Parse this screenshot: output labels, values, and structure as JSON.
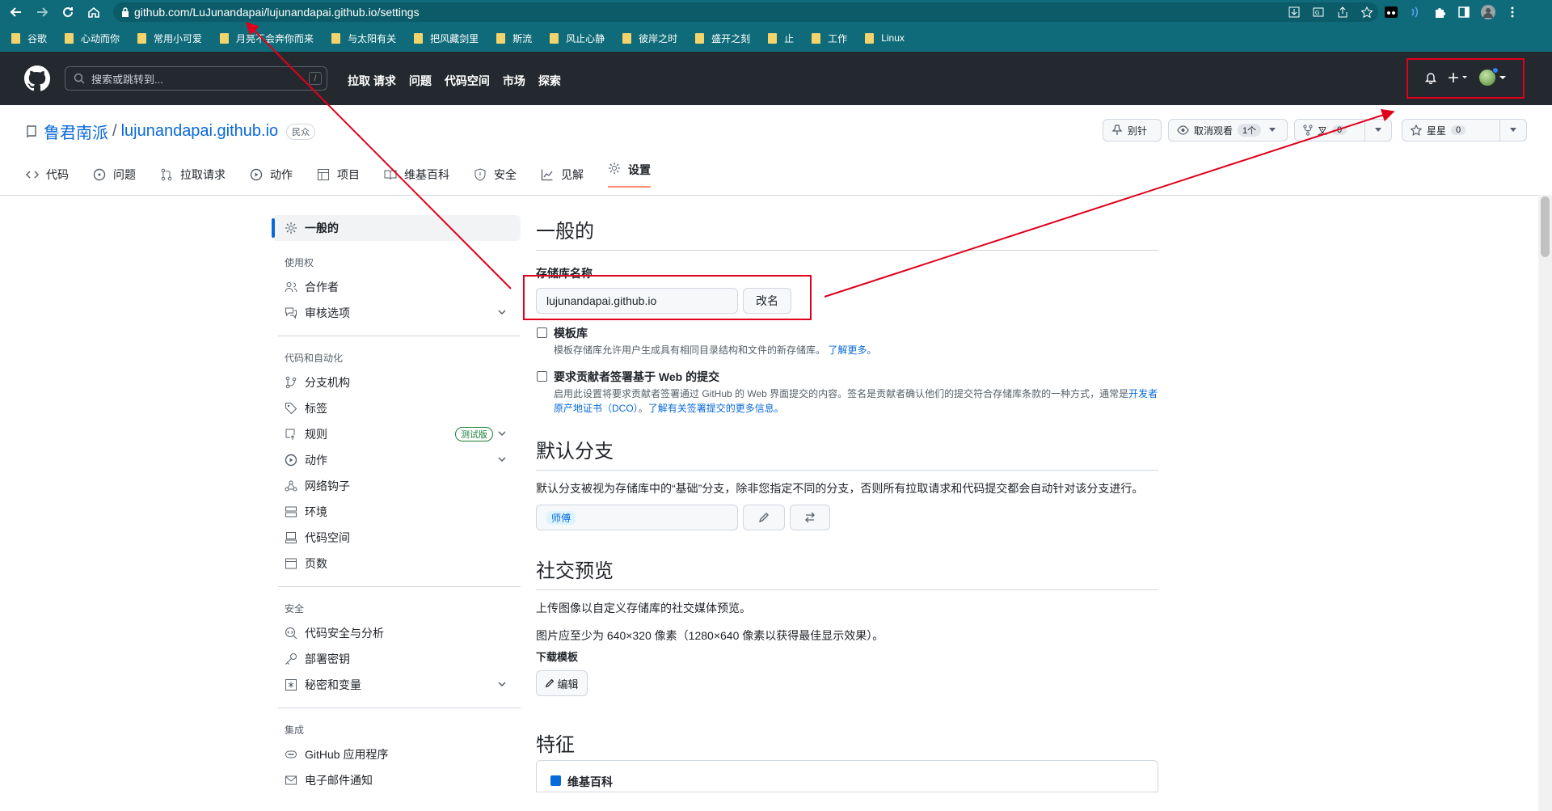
{
  "browser": {
    "url": "github.com/LuJunandapai/lujunandapai.github.io/settings",
    "bookmarks": [
      "谷歌",
      "心动而你",
      "常用小可爱",
      "月亮不会奔你而来",
      "与太阳有关",
      "把风藏剑里",
      "斯流",
      "风止心静",
      "彼岸之时",
      "盛开之刻",
      "止",
      "工作",
      "Linux"
    ]
  },
  "header": {
    "search_placeholder": "搜索或跳转到...",
    "search_hotkey": "/",
    "nav": [
      "拉取 请求",
      "问题",
      "代码空间",
      "市场",
      "探索"
    ]
  },
  "repo": {
    "owner": "鲁君南派",
    "separator": "/",
    "name": "lujunandapai.github.io",
    "visibility": "民众",
    "actions": {
      "pin": "别针",
      "unwatch": "取消观看",
      "watch_count": "1个",
      "fork_label": "叉",
      "fork_count": "0",
      "star": "星星",
      "star_count": "0"
    },
    "tabs": [
      "代码",
      "问题",
      "拉取请求",
      "动作",
      "项目",
      "维基百科",
      "安全",
      "见解",
      "设置"
    ]
  },
  "sidebar": {
    "active": "一般的",
    "groups": [
      {
        "heading": "使用权",
        "items": [
          "合作者",
          "审核选项"
        ]
      },
      {
        "heading": "代码和自动化",
        "items": [
          "分支机构",
          "标签",
          "规则",
          "动作",
          "网络钩子",
          "环境",
          "代码空间",
          "页数"
        ]
      },
      {
        "heading": "安全",
        "items": [
          "代码安全与分析",
          "部署密钥",
          "秘密和变量"
        ]
      },
      {
        "heading": "集成",
        "items": [
          "GitHub 应用程序",
          "电子邮件通知"
        ]
      }
    ],
    "beta_badge": "测试版"
  },
  "main": {
    "general_title": "一般的",
    "repo_name_label": "存储库名称",
    "repo_name_value": "lujunandapai.github.io",
    "rename_button": "改名",
    "template_title": "模板库",
    "template_desc": "模板存储库允许用户生成具有相同目录结构和文件的新存储库。",
    "learn_more": "了解更多。",
    "signoff_title": "要求贡献者签署基于 Web 的提交",
    "signoff_desc": "启用此设置将要求贡献者签署通过 GitHub 的 Web 界面提交的内容。签名是贡献者确认他们的提交符合存储库条款的一种方式，通常是",
    "signoff_link1": "开发者原产地证书（DCO）",
    "signoff_link2": "了解有关签署提交的更多信息。",
    "default_branch_title": "默认分支",
    "default_branch_desc": "默认分支被视为存储库中的“基础”分支，除非您指定不同的分支，否则所有拉取请求和代码提交都会自动针对该分支进行。",
    "default_branch_value": "师傅",
    "social_title": "社交预览",
    "social_desc1": "上传图像以自定义存储库的社交媒体预览。",
    "social_desc2": "图片应至少为 640×320 像素（1280×640 像素以获得最佳显示效果）。",
    "download_template": "下载模板",
    "edit_button": "编辑",
    "features_title": "特征",
    "features_first": "维基百科"
  },
  "colors": {
    "chrome": "#0f6b79",
    "github_header": "#24292f",
    "link": "#0969da",
    "annotation_red": "#e0001b",
    "active_tab_underline": "#fd8c73"
  }
}
